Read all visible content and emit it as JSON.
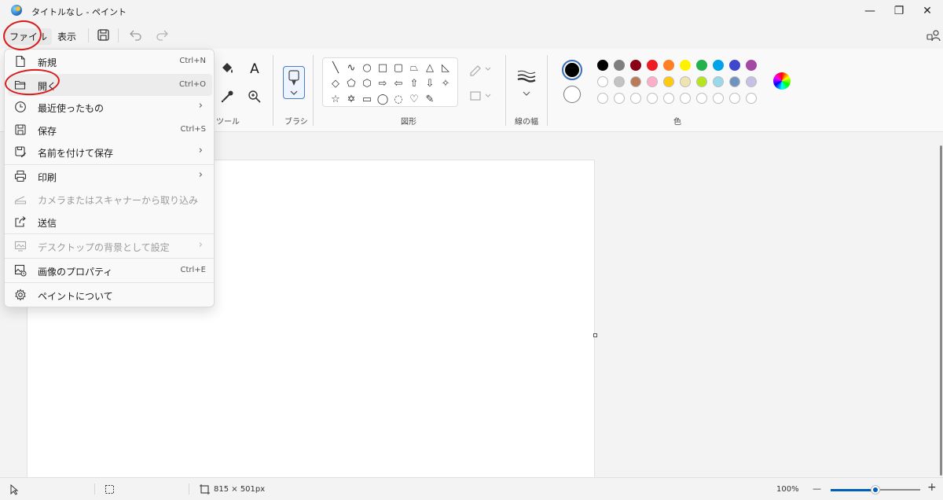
{
  "window": {
    "title": "タイトルなし - ペイント",
    "minimize_glyph": "—",
    "maximize_glyph": "❐",
    "close_glyph": "✕"
  },
  "menu": {
    "file_label": "ファイル",
    "view_label": "表示"
  },
  "ribbon": {
    "tools_label": "ツール",
    "brush_label": "ブラシ",
    "shapes_label": "図形",
    "size_label": "線の幅",
    "colors_label": "色",
    "text_tool_glyph": "A",
    "shape_glyphs": [
      "╲",
      "∿",
      "○",
      "□",
      "▢",
      "⏢",
      "△",
      "◺",
      "◇",
      "⬠",
      "⬡",
      "⇨",
      "⇦",
      "⇧",
      "⇩",
      "✧",
      "☆",
      "✡",
      "▭",
      "◯",
      "◌",
      "♡",
      "✎"
    ]
  },
  "colors": {
    "primary": "#000000",
    "secondary": "#ffffff",
    "row1": [
      "#000000",
      "#7f7f7f",
      "#880015",
      "#ed1c24",
      "#ff7f27",
      "#fff200",
      "#22b14c",
      "#00a2e8",
      "#3f48cc",
      "#a349a4"
    ],
    "row2": [
      "#ffffff",
      "#c3c3c3",
      "#b97a57",
      "#ffaec9",
      "#ffc90e",
      "#efe4b0",
      "#b5e61d",
      "#99d9ea",
      "#7092be",
      "#c8bfe7"
    ],
    "row3": [
      "#ffffff",
      "#ffffff",
      "#ffffff",
      "#ffffff",
      "#ffffff",
      "#ffffff",
      "#ffffff",
      "#ffffff",
      "#ffffff",
      "#ffffff"
    ]
  },
  "file_menu": {
    "items": [
      {
        "label": "新規",
        "shortcut": "Ctrl+N",
        "icon": "new-file-icon"
      },
      {
        "label": "開く",
        "shortcut": "Ctrl+O",
        "icon": "folder-open-icon"
      },
      {
        "label": "最近使ったもの",
        "chevron": "›",
        "icon": "clock-icon"
      },
      {
        "label": "保存",
        "shortcut": "Ctrl+S",
        "icon": "save-icon"
      },
      {
        "label": "名前を付けて保存",
        "chevron": "›",
        "icon": "save-as-icon"
      },
      {
        "label": "印刷",
        "chevron": "›",
        "icon": "printer-icon"
      },
      {
        "label": "カメラまたはスキャナーから取り込み",
        "icon": "scanner-icon"
      },
      {
        "label": "送信",
        "icon": "share-icon"
      },
      {
        "label": "デスクトップの背景として設定",
        "chevron": "›",
        "icon": "wallpaper-icon"
      },
      {
        "label": "画像のプロパティ",
        "shortcut": "Ctrl+E",
        "icon": "image-properties-icon"
      },
      {
        "label": "ペイントについて",
        "icon": "gear-icon"
      }
    ]
  },
  "status": {
    "canvas_size": "815 × 501px",
    "zoom": "100%",
    "zoom_out_glyph": "—",
    "zoom_in_glyph": "+",
    "zoom_level": 0.5
  }
}
